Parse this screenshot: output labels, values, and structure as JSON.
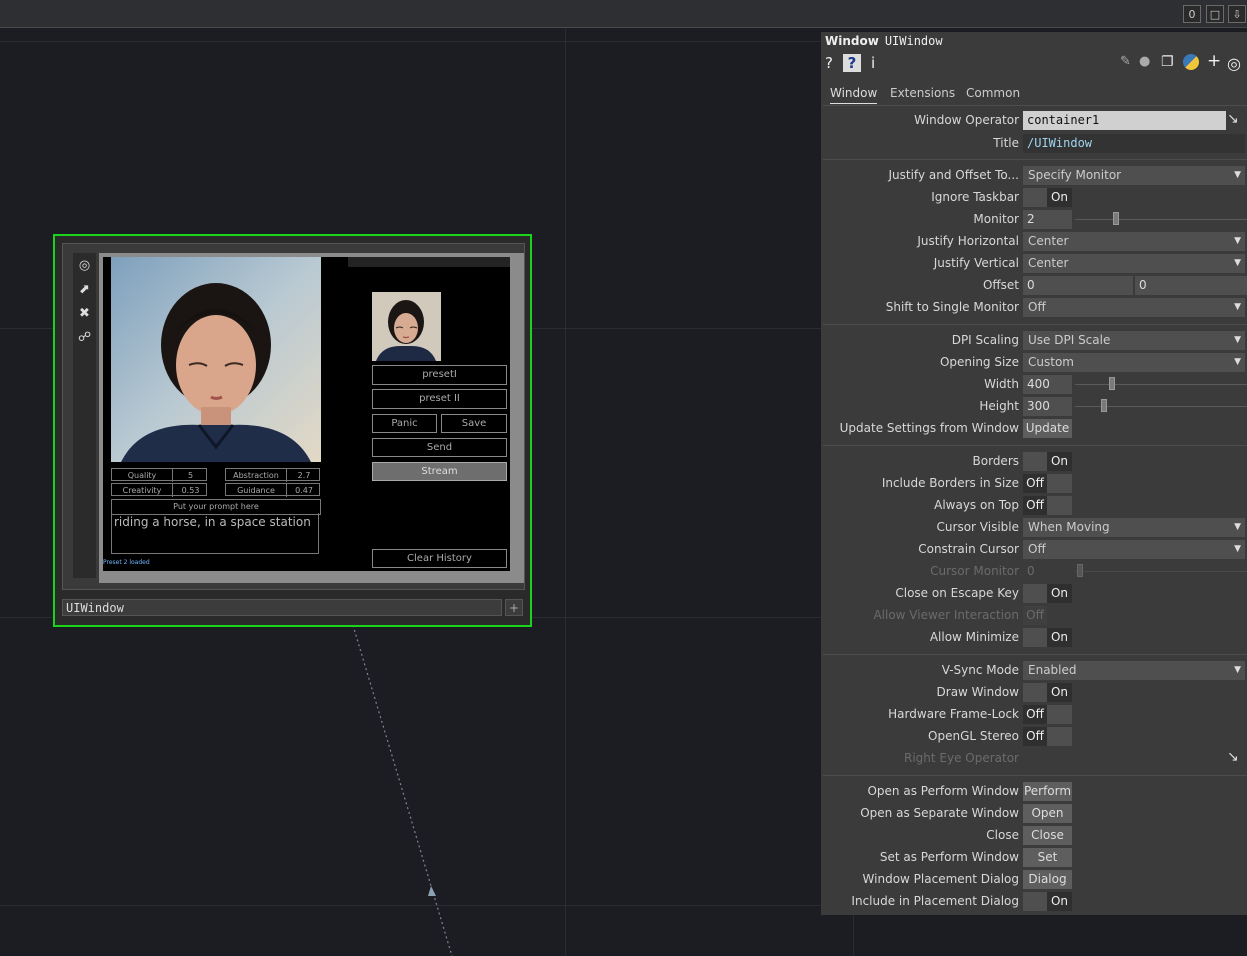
{
  "topbar": {
    "counter": "0",
    "window_icon": "window-icon",
    "pin_icon": "pin-icon"
  },
  "node": {
    "name": "UIWindow",
    "plus": "+",
    "tools": [
      "target-icon",
      "pulse-icon",
      "close-icon",
      "lock-icon"
    ],
    "preview": {
      "table": [
        {
          "label": "Quality",
          "value": "5"
        },
        {
          "label": "Creativity",
          "value": "0.53"
        },
        {
          "label": "Abstraction",
          "value": "2.7"
        },
        {
          "label": "Guidance",
          "value": "0.47"
        }
      ],
      "prompt_header": "Put your prompt here",
      "prompt_text": "riding a horse, in a space station",
      "status": "Preset 2 loaded",
      "buttons": {
        "preset1": "presetI",
        "preset2": "preset II",
        "panic": "Panic",
        "save": "Save",
        "send": "Send",
        "stream": "Stream",
        "clear": "Clear History"
      }
    }
  },
  "panel": {
    "type": "Window",
    "name": "UIWindow",
    "tabs": [
      "Window",
      "Extensions",
      "Common"
    ],
    "rows": {
      "window_operator": {
        "label": "Window Operator",
        "value": "container1"
      },
      "title": {
        "label": "Title",
        "value": "/UIWindow"
      },
      "justify_offset": {
        "label": "Justify and Offset To...",
        "value": "Specify Monitor"
      },
      "ignore_taskbar": {
        "label": "Ignore Taskbar",
        "value": "On"
      },
      "monitor": {
        "label": "Monitor",
        "value": "2"
      },
      "justify_h": {
        "label": "Justify Horizontal",
        "value": "Center"
      },
      "justify_v": {
        "label": "Justify Vertical",
        "value": "Center"
      },
      "offset": {
        "label": "Offset",
        "value1": "0",
        "value2": "0"
      },
      "shift_single": {
        "label": "Shift to Single Monitor",
        "value": "Off"
      },
      "dpi_scaling": {
        "label": "DPI Scaling",
        "value": "Use DPI Scale"
      },
      "opening_size": {
        "label": "Opening Size",
        "value": "Custom"
      },
      "width": {
        "label": "Width",
        "value": "400"
      },
      "height": {
        "label": "Height",
        "value": "300"
      },
      "update_settings": {
        "label": "Update Settings from Window",
        "value": "Update"
      },
      "borders": {
        "label": "Borders",
        "value": "On"
      },
      "include_borders": {
        "label": "Include Borders in Size",
        "value": "Off"
      },
      "always_on_top": {
        "label": "Always on Top",
        "value": "Off"
      },
      "cursor_visible": {
        "label": "Cursor Visible",
        "value": "When Moving"
      },
      "constrain_cursor": {
        "label": "Constrain Cursor",
        "value": "Off"
      },
      "cursor_monitor": {
        "label": "Cursor Monitor",
        "value": "0"
      },
      "close_escape": {
        "label": "Close on Escape Key",
        "value": "On"
      },
      "allow_viewer": {
        "label": "Allow Viewer Interaction",
        "value": "Off"
      },
      "allow_minimize": {
        "label": "Allow Minimize",
        "value": "On"
      },
      "vsync": {
        "label": "V-Sync Mode",
        "value": "Enabled"
      },
      "draw_window": {
        "label": "Draw Window",
        "value": "On"
      },
      "hw_framelock": {
        "label": "Hardware Frame-Lock",
        "value": "Off"
      },
      "opengl_stereo": {
        "label": "OpenGL Stereo",
        "value": "Off"
      },
      "right_eye": {
        "label": "Right Eye Operator"
      },
      "open_perform": {
        "label": "Open as Perform Window",
        "value": "Perform"
      },
      "open_separate": {
        "label": "Open as Separate Window",
        "value": "Open"
      },
      "close": {
        "label": "Close",
        "value": "Close"
      },
      "set_perform": {
        "label": "Set as Perform Window",
        "value": "Set"
      },
      "placement_dialog": {
        "label": "Window Placement Dialog",
        "value": "Dialog"
      },
      "include_placement": {
        "label": "Include in Placement Dialog",
        "value": "On"
      }
    }
  }
}
